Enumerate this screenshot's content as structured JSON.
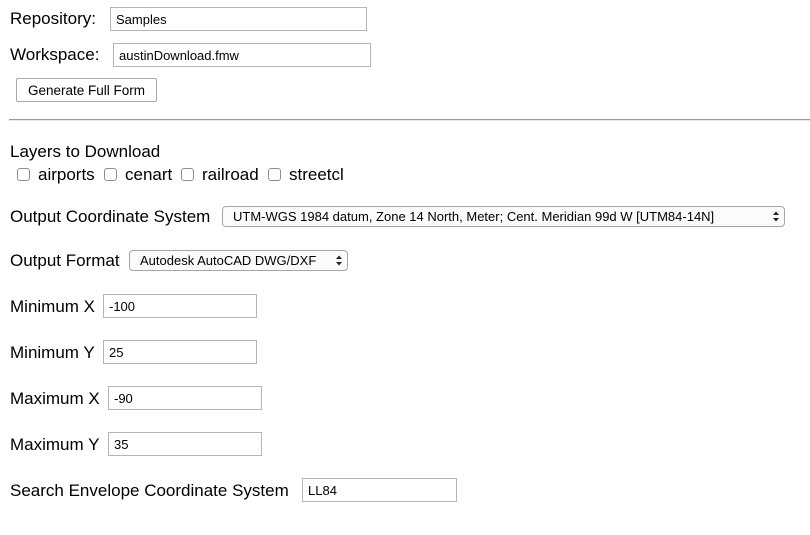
{
  "repository": {
    "label": "Repository:",
    "value": "Samples"
  },
  "workspace": {
    "label": "Workspace:",
    "value": "austinDownload.fmw"
  },
  "generate_button": {
    "label": "Generate Full Form"
  },
  "layers": {
    "title": "Layers to Download",
    "items": [
      {
        "label": "airports",
        "checked": false
      },
      {
        "label": "cenart",
        "checked": false
      },
      {
        "label": "railroad",
        "checked": false
      },
      {
        "label": "streetcl",
        "checked": false
      }
    ]
  },
  "output_coord_system": {
    "label": "Output Coordinate System",
    "selected": "UTM-WGS 1984 datum, Zone 14 North, Meter; Cent. Meridian 99d W [UTM84-14N]"
  },
  "output_format": {
    "label": "Output Format",
    "selected": "Autodesk AutoCAD DWG/DXF"
  },
  "min_x": {
    "label": "Minimum X",
    "value": "-100"
  },
  "min_y": {
    "label": "Minimum Y",
    "value": "25"
  },
  "max_x": {
    "label": "Maximum X",
    "value": "-90"
  },
  "max_y": {
    "label": "Maximum Y",
    "value": "35"
  },
  "search_env_coord": {
    "label": "Search Envelope Coordinate System",
    "value": "LL84"
  },
  "icons": {
    "select_arrows": "updown-chevron-icon"
  }
}
